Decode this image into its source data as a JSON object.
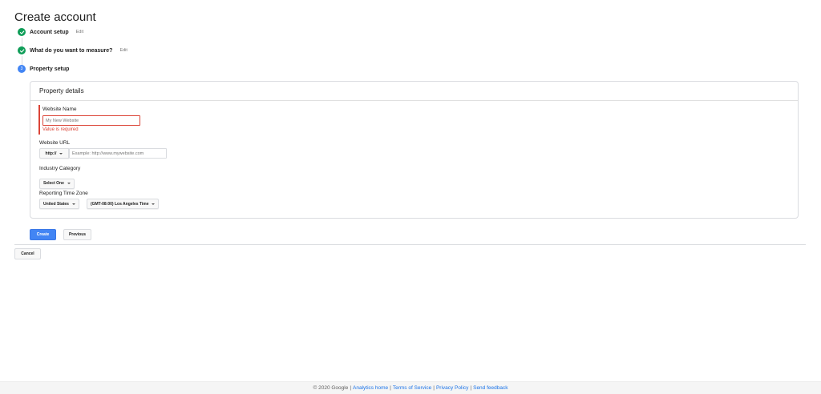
{
  "page": {
    "title": "Create account"
  },
  "stepper": {
    "steps": [
      {
        "label": "Account setup",
        "edit": "Edit",
        "status": "done"
      },
      {
        "label": "What do you want to measure?",
        "edit": "Edit",
        "status": "done"
      },
      {
        "label": "Property setup",
        "number": "3",
        "status": "active"
      }
    ]
  },
  "property_details": {
    "header": "Property details",
    "website_name": {
      "label": "Website Name",
      "placeholder": "My New Website",
      "value": "",
      "error": "Value is required"
    },
    "website_url": {
      "label": "Website URL",
      "protocol": "http://",
      "placeholder": "Example: http://www.mywebsite.com",
      "value": ""
    },
    "industry_category": {
      "label": "Industry Category",
      "selected": "Select One"
    },
    "reporting_time_zone": {
      "label": "Reporting Time Zone",
      "country": "United States",
      "zone": "(GMT-08:00) Los Angeles Time"
    }
  },
  "actions": {
    "create_label": "Create",
    "previous_label": "Previous",
    "cancel_label": "Cancel"
  },
  "footer": {
    "copyright": "© 2020 Google",
    "links": [
      "Analytics home",
      "Terms of Service",
      "Privacy Policy",
      "Send feedback"
    ]
  },
  "colors": {
    "done": "#0f9d58",
    "active": "#4285f4",
    "error": "#db4437",
    "primary_button": "#4285f4",
    "link": "#1a73e8"
  }
}
